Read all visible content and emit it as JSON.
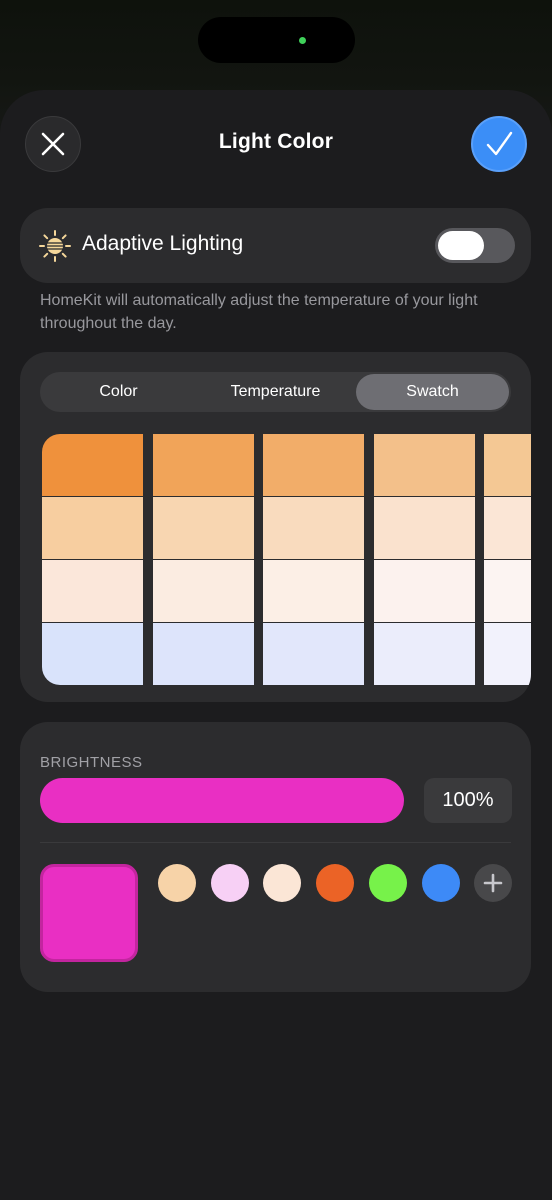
{
  "header": {
    "title": "Light Color",
    "close_icon": "close-icon",
    "done_icon": "checkmark-icon"
  },
  "adaptive_lighting": {
    "label": "Adaptive Lighting",
    "icon": "sun-icon",
    "enabled": false,
    "description": "HomeKit will automatically adjust the temperature of your light throughout the day."
  },
  "tabs": [
    {
      "label": "Color",
      "active": false
    },
    {
      "label": "Temperature",
      "active": false
    },
    {
      "label": "Swatch",
      "active": true
    }
  ],
  "swatches": [
    [
      "#ef913c",
      "#f7cea0",
      "#fbe7da",
      "#d9e3fb"
    ],
    [
      "#f1a459",
      "#f8d6b1",
      "#fbece1",
      "#dde4fb"
    ],
    [
      "#f2ad69",
      "#f9dbbe",
      "#fcefe6",
      "#e2e7fb"
    ],
    [
      "#f3c08a",
      "#fae2ce",
      "#fcf2ee",
      "#ebedfb"
    ],
    [
      "#f4c894",
      "#fbe6d6",
      "#fcf4f2",
      "#f2f2fc"
    ]
  ],
  "brightness": {
    "label": "BRIGHTNESS",
    "value_text": "100%",
    "level": 1.0,
    "color": "#e92fc3"
  },
  "current_color": "#e92fc3",
  "presets": [
    "#f7d3a8",
    "#f7d0f5",
    "#fbe6d6",
    "#eb6326",
    "#77f24a",
    "#3d8af7"
  ],
  "add_icon": "plus-icon",
  "colors": {
    "accent": "#3b8ef7",
    "background": "#1c1c1e",
    "card": "#2c2c2e"
  }
}
